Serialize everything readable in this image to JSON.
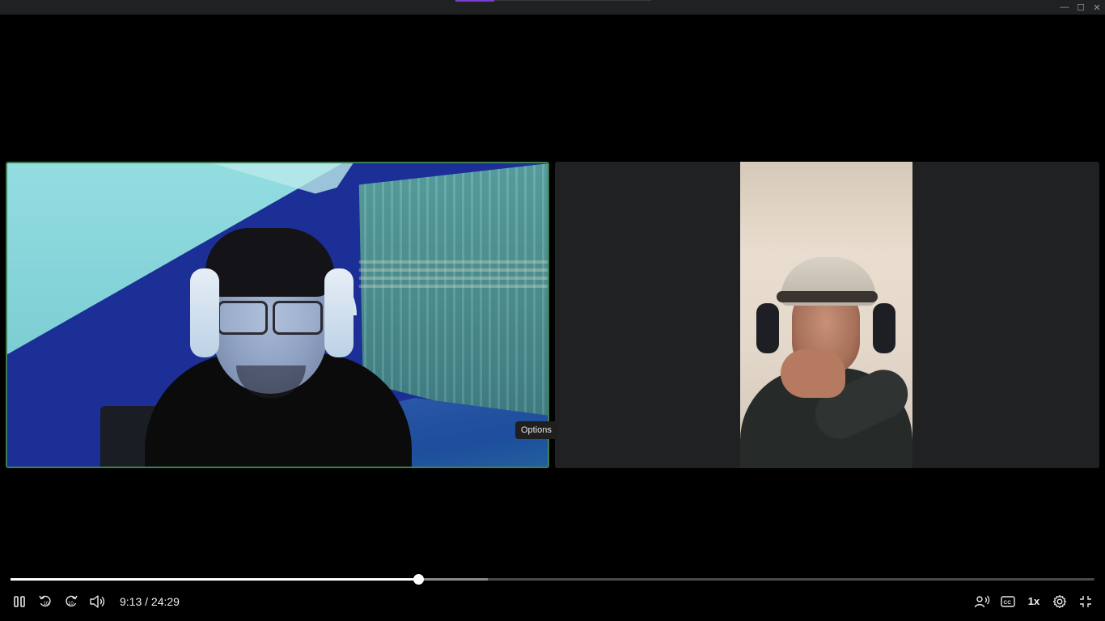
{
  "window": {
    "minimize_glyph": "—",
    "maximize_glyph": "☐",
    "close_glyph": "✕"
  },
  "tooltip": {
    "text": "Options"
  },
  "player": {
    "current_time": "9:13",
    "duration": "24:29",
    "time_display": "9:13 / 24:29",
    "progress_fraction": 0.376,
    "buffered_fraction": 0.44,
    "speed_label": "1x"
  },
  "icons": {
    "play_pause": "pause-icon",
    "rewind": "rewind-10-icon",
    "forward": "forward-10-icon",
    "volume": "volume-icon",
    "audio_description": "audio-description-icon",
    "captions": "closed-captions-icon",
    "settings": "gear-icon",
    "fullscreen": "exit-fullscreen-icon"
  },
  "colors": {
    "accent": "#7b3fd1",
    "active_speaker_border": "#3f7e55",
    "tile_background": "#202123"
  }
}
